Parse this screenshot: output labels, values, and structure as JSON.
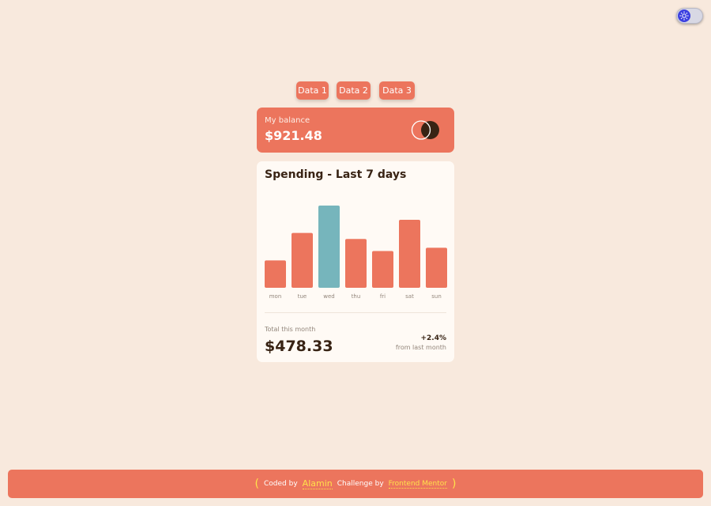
{
  "theme_toggle": {
    "icon": "sun-icon",
    "color": "#3b3fe0"
  },
  "data_buttons": [
    {
      "label": "Data 1"
    },
    {
      "label": "Data 2"
    },
    {
      "label": "Data 3"
    }
  ],
  "balance": {
    "label": "My balance",
    "amount": "$921.48",
    "icon": "mastercard-logo"
  },
  "spending": {
    "title": "Spending - Last 7 days",
    "total_label": "Total this month",
    "total_amount": "$478.33",
    "change": "+2.4%",
    "change_label": "from last month"
  },
  "chart_data": {
    "type": "bar",
    "categories": [
      "mon",
      "tue",
      "wed",
      "thu",
      "fri",
      "sat",
      "sun"
    ],
    "values": [
      17.45,
      34.91,
      52.36,
      31.07,
      23.39,
      43.28,
      25.48
    ],
    "highlight_index": 2,
    "bar_color": "#ec755d",
    "highlight_color": "#76b5bc"
  },
  "footer": {
    "open_paren": "(",
    "coded_by": "Coded by",
    "author": "Alamin",
    "challenge_by": "Challenge by",
    "challenge_link": "Frontend Mentor",
    "close_paren": ")"
  },
  "colors": {
    "accent": "#ec755d",
    "background": "#f8e9dd",
    "card": "#fffaf5",
    "link": "#ffe14a"
  }
}
